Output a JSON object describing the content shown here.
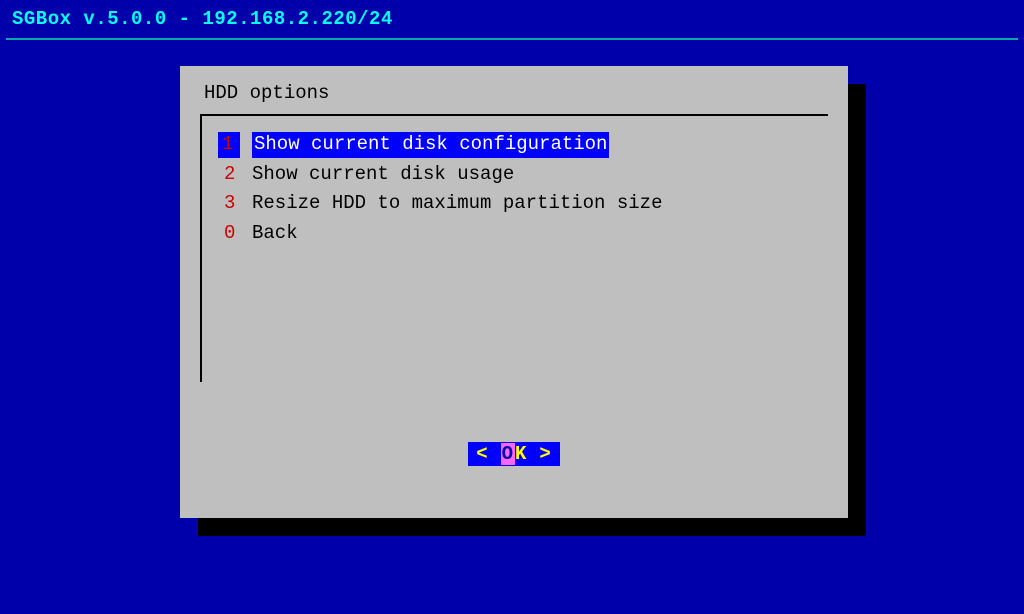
{
  "header": {
    "title": "SGBox v.5.0.0 - 192.168.2.220/24"
  },
  "dialog": {
    "title": "HDD options",
    "menu": [
      {
        "num": "1",
        "label": "Show current disk configuration",
        "selected": true
      },
      {
        "num": "2",
        "label": "Show current disk usage",
        "selected": false
      },
      {
        "num": "3",
        "label": "Resize HDD to maximum partition size",
        "selected": false
      },
      {
        "num": "0",
        "label": "Back",
        "selected": false
      }
    ],
    "button": {
      "left_angle": "<",
      "ok_o": "O",
      "ok_k": "K",
      "right_angle": ">"
    }
  }
}
